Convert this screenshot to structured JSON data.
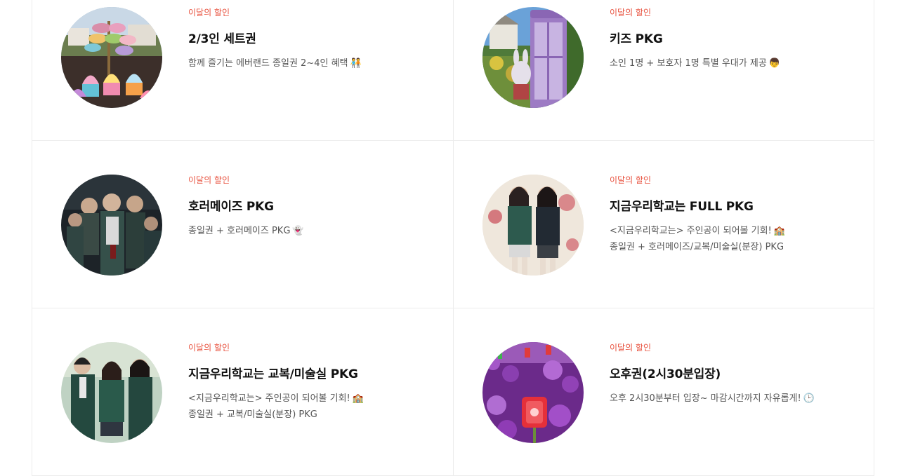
{
  "products": [
    {
      "tag": "이달의 할인",
      "title": "2/3인 세트권",
      "lines": [
        {
          "text": "함께 즐기는 에버랜드 종일권 2~4인 혜택",
          "emoji": "🧑‍🤝‍🧑"
        }
      ],
      "image_icon": "macaron-cupcake-photo"
    },
    {
      "tag": "이달의 할인",
      "title": "키즈 PKG",
      "lines": [
        {
          "text": "소인 1명 + 보호자 1명 특별 우대가 제공",
          "emoji": "👦"
        }
      ],
      "image_icon": "purple-phone-booth-photo"
    },
    {
      "tag": "이달의 할인",
      "title": "호러메이즈 PKG",
      "lines": [
        {
          "text": "종일권 + 호러메이즈 PKG",
          "emoji": "👻"
        }
      ],
      "image_icon": "horror-students-photo"
    },
    {
      "tag": "이달의 할인",
      "title": "지금우리학교는 FULL PKG",
      "lines": [
        {
          "text": "<지금우리학교는> 주인공이 되어볼 기회!",
          "emoji": "🏫"
        },
        {
          "text": "종일권 + 호러메이즈/교복/미술실(분장) PKG",
          "emoji": ""
        }
      ],
      "image_icon": "school-uniform-duo-photo"
    },
    {
      "tag": "이달의 할인",
      "title": "지금우리학교는 교복/미술실 PKG",
      "lines": [
        {
          "text": "<지금우리학교는> 주인공이 되어볼 기회!",
          "emoji": "🏫"
        },
        {
          "text": "종일권 + 교복/미술실(분장) PKG",
          "emoji": ""
        }
      ],
      "image_icon": "school-uniform-trio-photo"
    },
    {
      "tag": "이달의 할인",
      "title": "오후권(2시30분입장)",
      "lines": [
        {
          "text": "오후 2시30분부터 입장~ 마감시간까지 자유롭게!",
          "emoji": "🕒"
        }
      ],
      "image_icon": "purple-flower-field-photo"
    }
  ],
  "colors": {
    "accent": "#e8523f",
    "border": "#ececec",
    "title": "#111111",
    "description": "#555555"
  }
}
